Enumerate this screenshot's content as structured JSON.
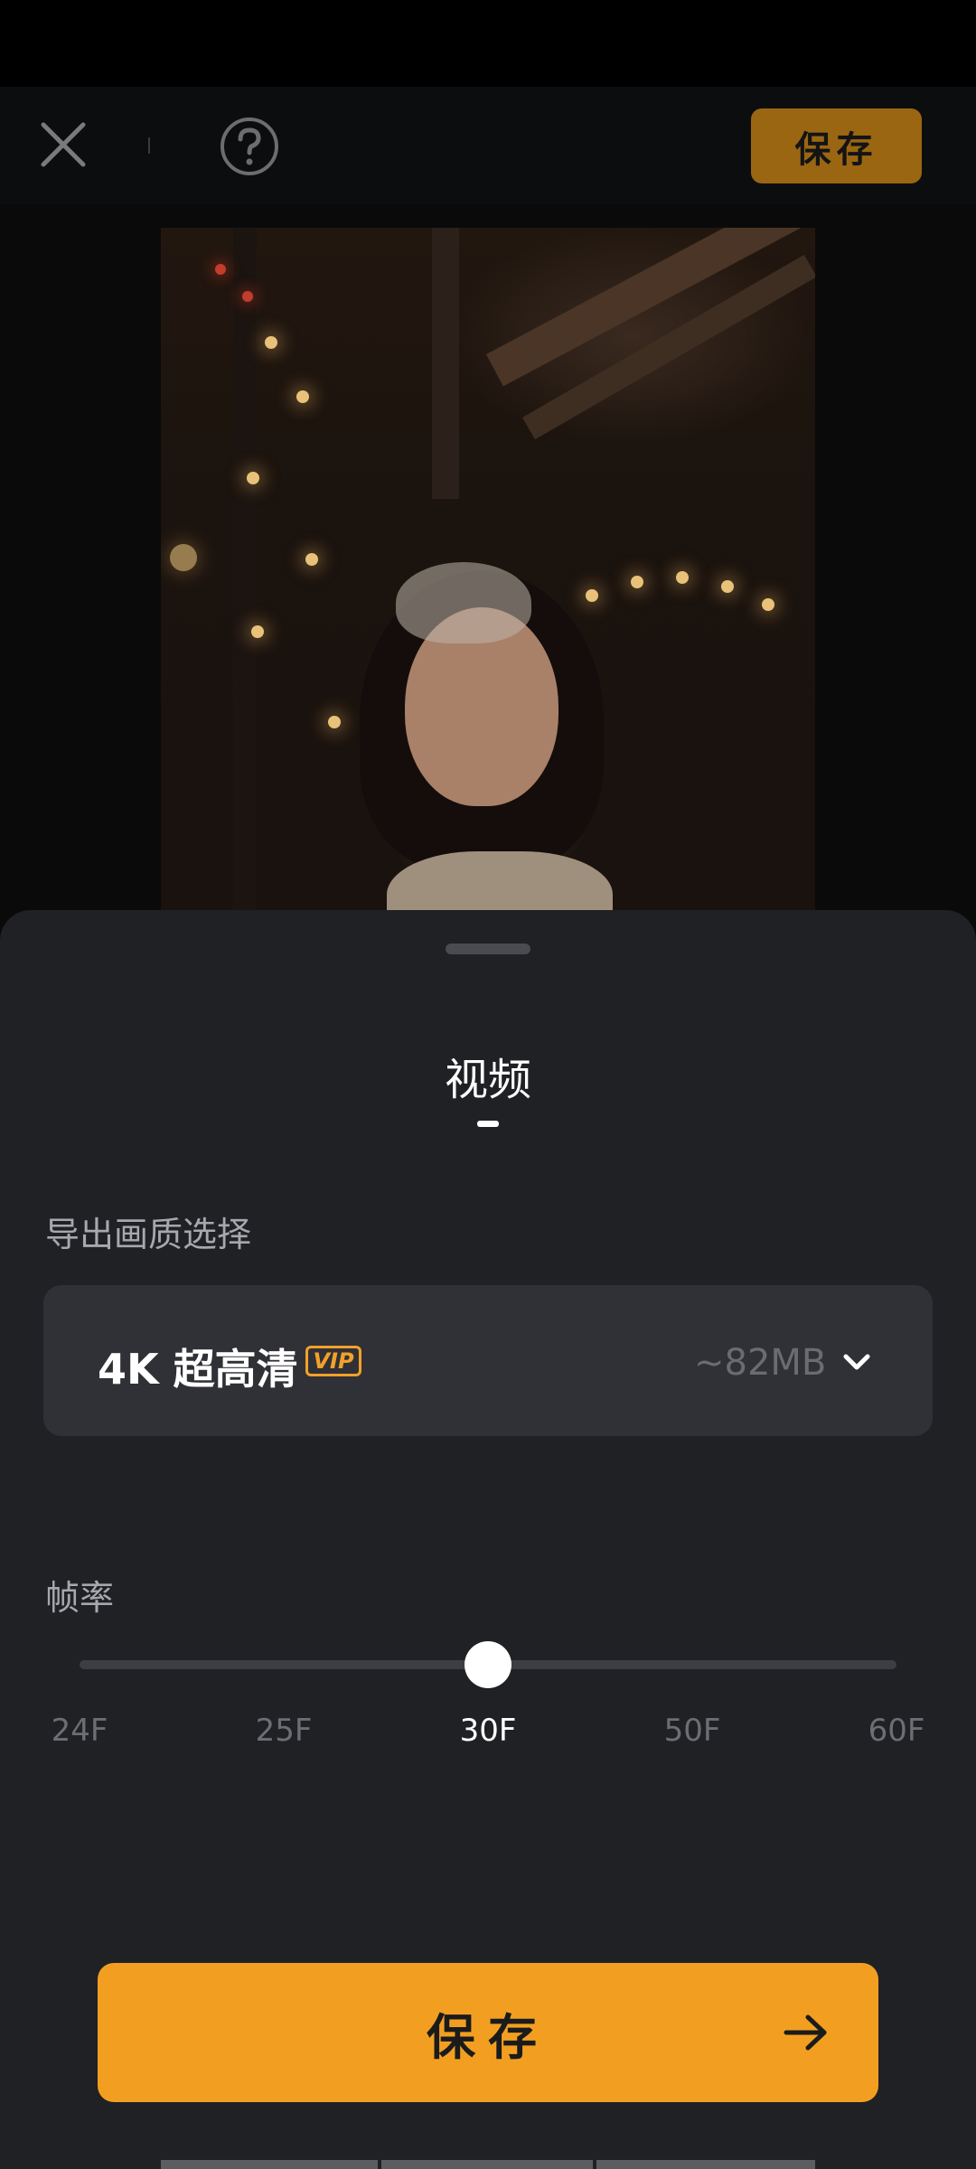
{
  "topbar": {
    "close_icon": "close-icon",
    "help_icon": "help-icon",
    "save_label": "保存"
  },
  "sheet": {
    "title": "视频",
    "quality": {
      "section_label": "导出画质选择",
      "selected": "4K 超高清",
      "badge": "VIP",
      "size": "~82MB",
      "dropdown_icon": "chevron-down-icon"
    },
    "framerate": {
      "section_label": "帧率",
      "options": [
        "24F",
        "25F",
        "30F",
        "50F",
        "60F"
      ],
      "selected_index": 2
    },
    "save_button": {
      "label": "保存",
      "icon": "arrow-right-icon"
    }
  },
  "colors": {
    "accent": "#f29f21",
    "sheet_bg": "#202125",
    "select_bg": "#303136",
    "vip": "#f2a12a"
  }
}
